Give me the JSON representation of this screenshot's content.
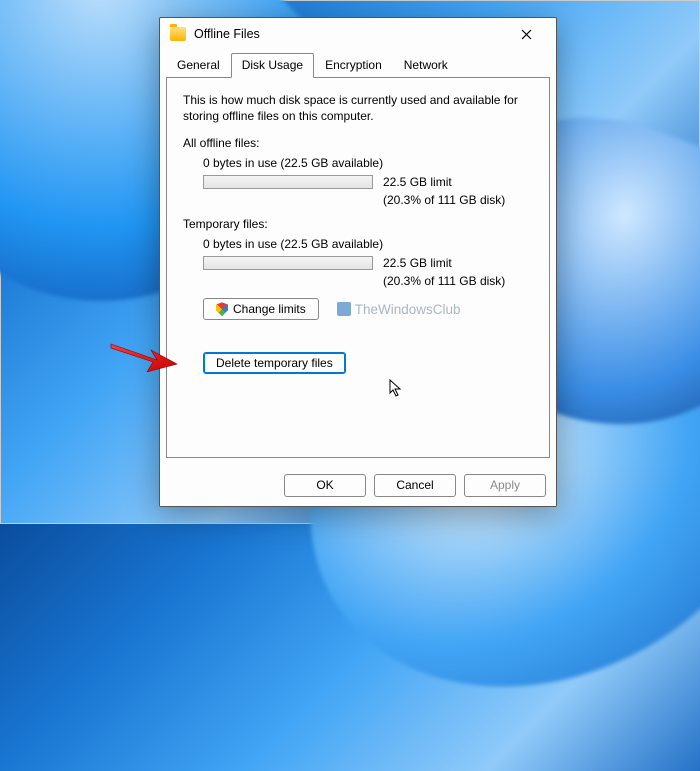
{
  "window": {
    "title": "Offline Files"
  },
  "tabs": {
    "items": [
      {
        "label": "General"
      },
      {
        "label": "Disk Usage"
      },
      {
        "label": "Encryption"
      },
      {
        "label": "Network"
      }
    ],
    "active": 1
  },
  "panel": {
    "description": "This is how much disk space is currently used and available for storing offline files on this computer.",
    "all_offline": {
      "label": "All offline files:",
      "usage": "0 bytes in use (22.5 GB available)",
      "limit": "22.5 GB limit",
      "pct": "(20.3% of 111 GB disk)"
    },
    "temp": {
      "label": "Temporary files:",
      "usage": "0 bytes in use (22.5 GB available)",
      "limit": "22.5 GB limit",
      "pct": "(20.3% of 111 GB disk)"
    },
    "change_limits_label": "Change limits",
    "watermark": "TheWindowsClub",
    "delete_temp_label": "Delete temporary files"
  },
  "footer": {
    "ok": "OK",
    "cancel": "Cancel",
    "apply": "Apply"
  }
}
